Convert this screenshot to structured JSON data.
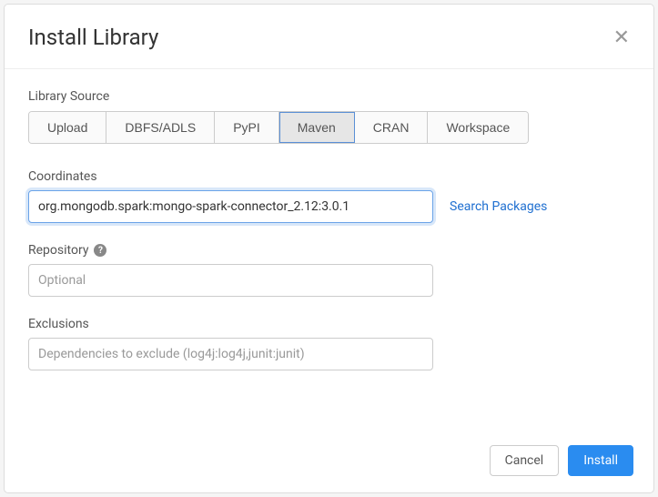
{
  "header": {
    "title": "Install Library"
  },
  "librarySource": {
    "label": "Library Source",
    "tabs": [
      "Upload",
      "DBFS/ADLS",
      "PyPI",
      "Maven",
      "CRAN",
      "Workspace"
    ],
    "selectedIndex": 3
  },
  "coordinates": {
    "label": "Coordinates",
    "value": "org.mongodb.spark:mongo-spark-connector_2.12:3.0.1",
    "searchLink": "Search Packages"
  },
  "repository": {
    "label": "Repository",
    "placeholder": "Optional"
  },
  "exclusions": {
    "label": "Exclusions",
    "placeholder": "Dependencies to exclude (log4j:log4j,junit:junit)"
  },
  "footer": {
    "cancel": "Cancel",
    "install": "Install"
  }
}
